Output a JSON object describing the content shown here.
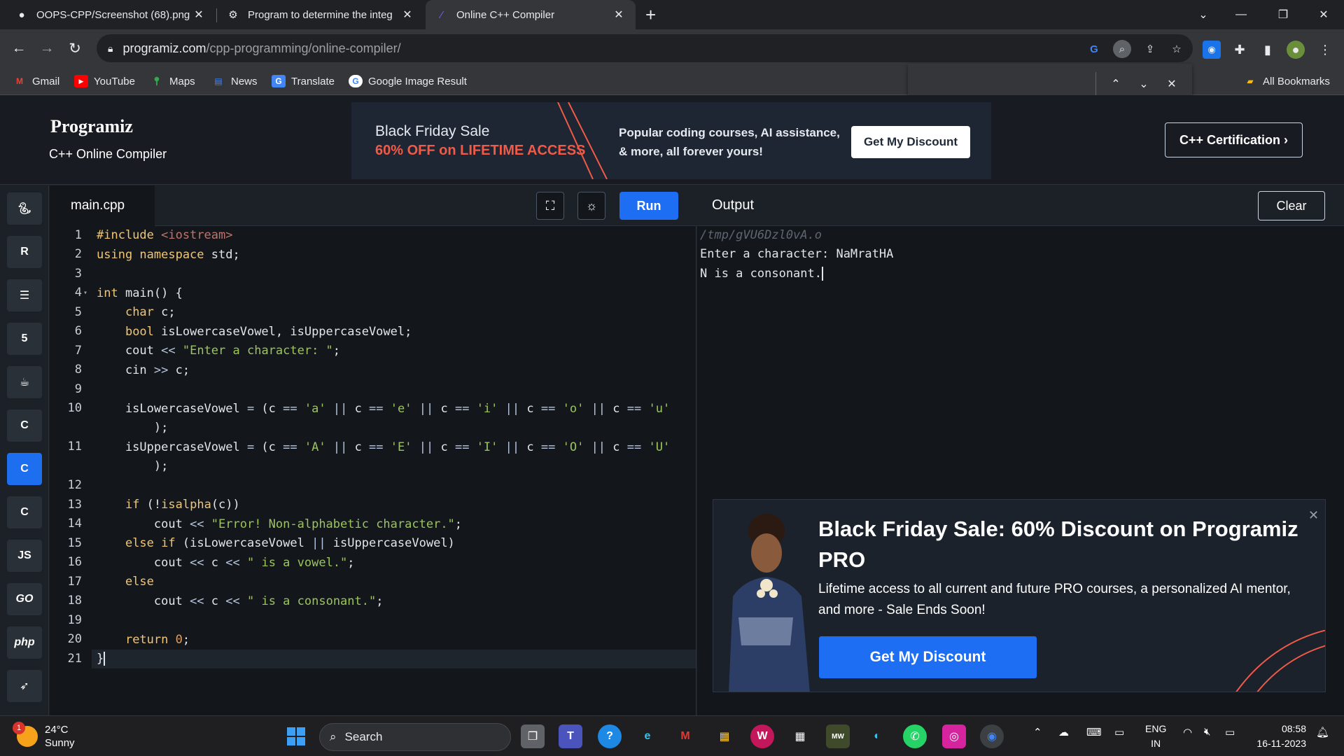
{
  "browser": {
    "tabs": [
      {
        "title": "OOPS-CPP/Screenshot (68).png",
        "icon": "github-icon"
      },
      {
        "title": "Program to determine the integ",
        "icon": "settings-gear-icon"
      },
      {
        "title": "Online C++ Compiler",
        "icon": "programiz-icon"
      }
    ],
    "url_host": "programiz.com",
    "url_path": "/cpp-programming/online-compiler/",
    "bookmarks": [
      "Gmail",
      "YouTube",
      "Maps",
      "News",
      "Translate",
      "Google Image Result"
    ],
    "all_bookmarks": "All Bookmarks"
  },
  "site": {
    "logo": "Programiz",
    "subtitle": "C++ Online Compiler",
    "banner": {
      "line1": "Black Friday Sale",
      "line2": "60% OFF on LIFETIME ACCESS",
      "text": "Popular coding courses, AI assistance, & more, all forever yours!",
      "button": "Get My Discount"
    },
    "certification": "C++ Certification ›"
  },
  "rail": {
    "languages": [
      "python",
      "r",
      "sql",
      "html",
      "java",
      "c",
      "cpp",
      "csharp",
      "JS",
      "GO",
      "php",
      "swift"
    ]
  },
  "editor": {
    "filename": "main.cpp",
    "run_label": "Run",
    "line_numbers": [
      "1",
      "2",
      "3",
      "4",
      "5",
      "6",
      "7",
      "8",
      "9",
      "10",
      "",
      "11",
      "",
      "12",
      "13",
      "14",
      "15",
      "16",
      "17",
      "18",
      "19",
      "20",
      "21"
    ]
  },
  "output": {
    "title": "Output",
    "clear_label": "Clear",
    "lines": [
      "/tmp/gVU6Dzl0vA.o",
      "Enter a character: NaMratHA",
      "N is a consonant."
    ]
  },
  "promo": {
    "title": "Black Friday Sale: 60% Discount on Programiz PRO",
    "body": "Lifetime access to all current and future PRO courses, a personalized AI mentor, and more - Sale Ends Soon!",
    "button": "Get My Discount"
  },
  "taskbar": {
    "temp": "24°C",
    "condition": "Sunny",
    "weather_badge": "1",
    "search": "Search",
    "lang1": "ENG",
    "lang2": "IN",
    "time": "08:58",
    "date": "16-11-2023"
  },
  "colors": {
    "accent": "#1d6ef2",
    "banner_highlight": "#f05a47"
  }
}
